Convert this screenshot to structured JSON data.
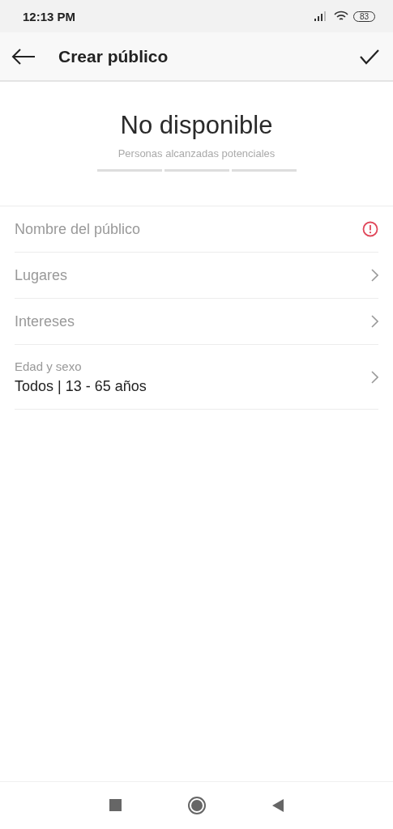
{
  "status_bar": {
    "time": "12:13 PM",
    "battery": "83"
  },
  "header": {
    "title": "Crear público"
  },
  "reach": {
    "value": "No disponible",
    "caption": "Personas alcanzadas potenciales"
  },
  "rows": [
    {
      "kind": "error",
      "label": "Nombre del público"
    },
    {
      "kind": "link",
      "label": "Lugares"
    },
    {
      "kind": "link",
      "label": "Intereses"
    },
    {
      "kind": "value",
      "label": "Edad y sexo",
      "value": "Todos | 13 - 65 años"
    }
  ]
}
